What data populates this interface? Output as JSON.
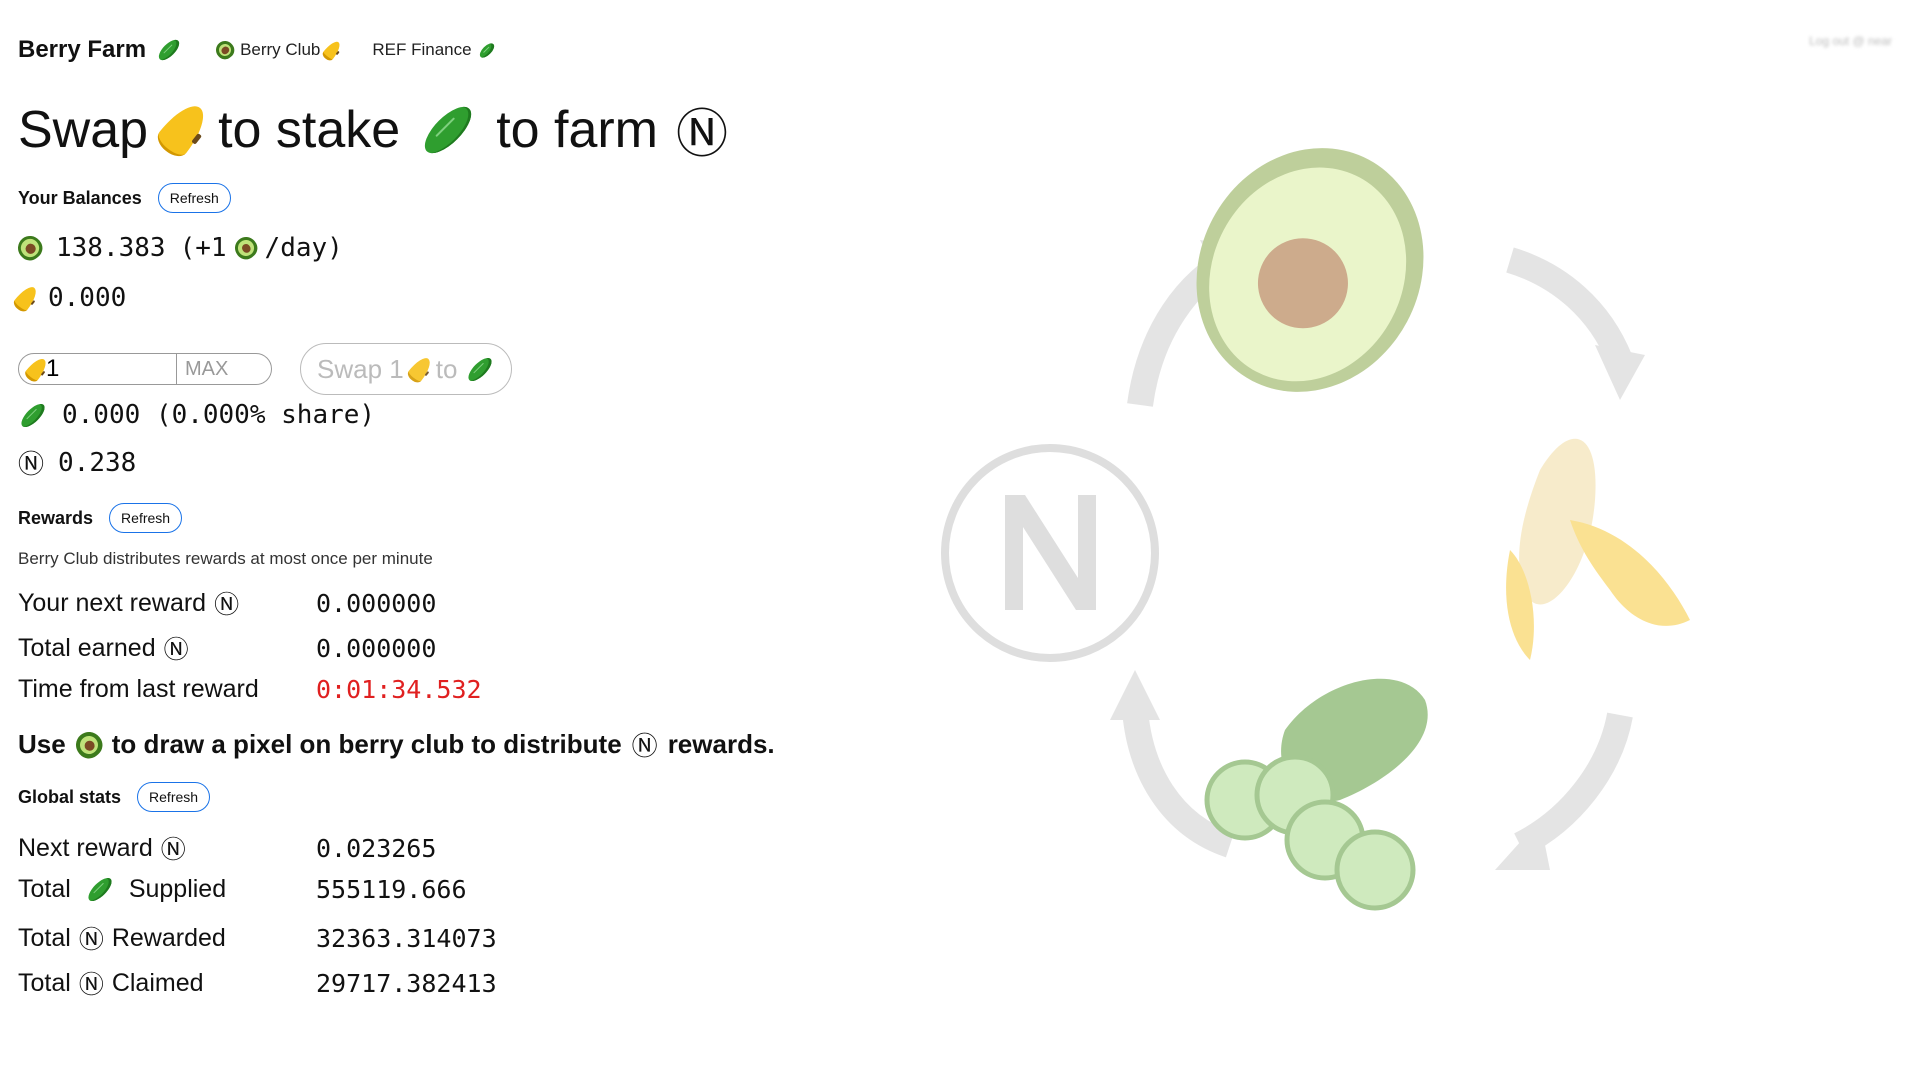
{
  "header": {
    "brand": "Berry Farm",
    "links": [
      {
        "label": "Berry Club"
      },
      {
        "label": "REF Finance"
      }
    ],
    "login": "Log out @ near"
  },
  "hero": {
    "w1": "Swap",
    "w2": "to stake",
    "w3": "to farm",
    "near_symbol": "Ⓝ"
  },
  "balances": {
    "title": "Your Balances",
    "refresh": "Refresh",
    "avocado": "138.383",
    "avocado_rate_open": "(+1",
    "avocado_rate_close": "/day)",
    "banana": "0.000",
    "cucumber": "0.000 (0.000% share)",
    "near": "0.238"
  },
  "swap": {
    "amount": "1",
    "max_label": "MAX",
    "button_prefix": "Swap 1",
    "button_to": "to"
  },
  "rewards": {
    "title": "Rewards",
    "refresh": "Refresh",
    "note": "Berry Club distributes rewards at most once per minute",
    "rows": [
      {
        "label": "Your next reward",
        "value": "0.000000"
      },
      {
        "label": "Total earned",
        "value": "0.000000"
      },
      {
        "label": "Time from last reward",
        "value": "0:01:34.532"
      }
    ],
    "callout_a": "Use",
    "callout_b": "to draw a pixel on berry club to distribute",
    "callout_c": "rewards."
  },
  "global": {
    "title": "Global stats",
    "refresh": "Refresh",
    "rows": [
      {
        "label": "Next reward",
        "value": "0.023265"
      },
      {
        "label_a": "Total",
        "label_b": "Supplied",
        "value": "555119.666"
      },
      {
        "label_a": "Total",
        "label_b": "Rewarded",
        "value": "32363.314073"
      },
      {
        "label_a": "Total",
        "label_b": "Claimed",
        "value": "29717.382413"
      }
    ]
  },
  "colors": {
    "refresh_border": "#1a73e8",
    "timer": "#e02020"
  },
  "icons": [
    "cucumber-icon",
    "avocado-icon",
    "banana-icon",
    "near-icon"
  ]
}
